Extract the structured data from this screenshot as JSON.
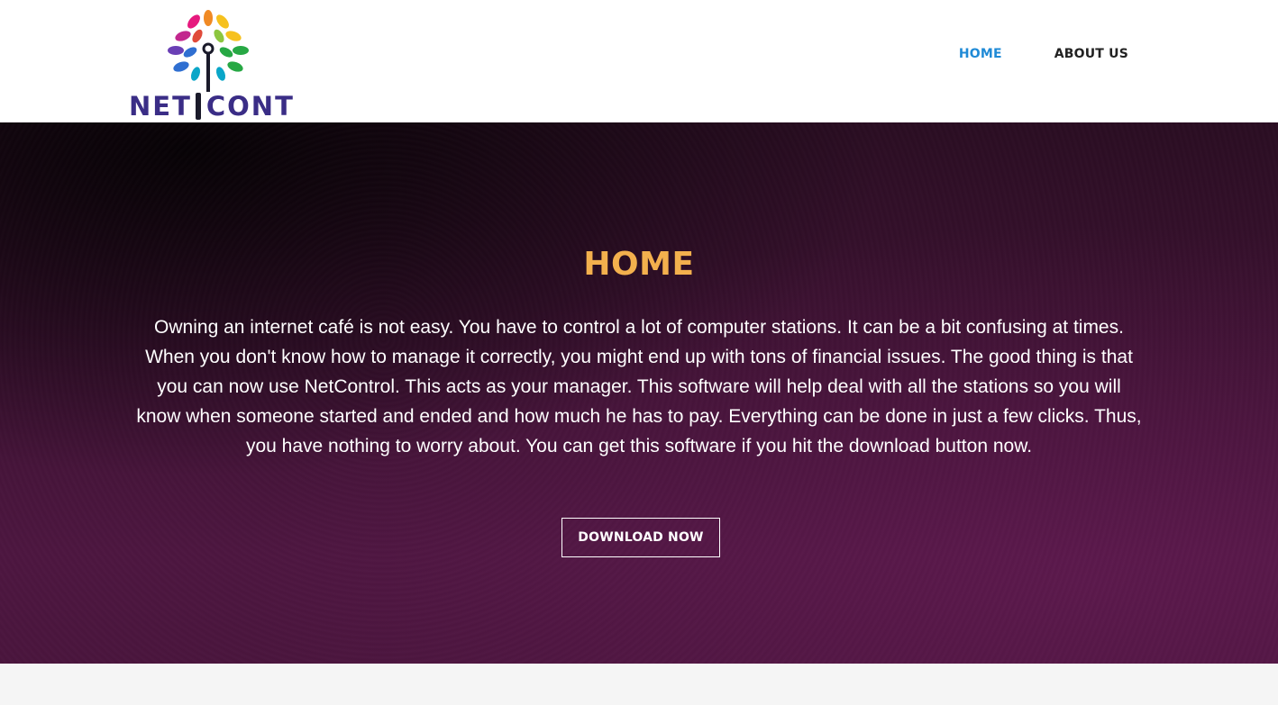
{
  "brand": {
    "name_left": "NET",
    "name_right": "CONT",
    "logo_icon": "tree-of-petals-icon",
    "brand_color": "#3a2d86",
    "petal_colors": [
      "#e6197e",
      "#f08a24",
      "#f6c11e",
      "#8dc63f",
      "#27a844",
      "#0aa6c8",
      "#2f6fd1",
      "#6a3fb5",
      "#c2278e"
    ]
  },
  "nav": {
    "items": [
      {
        "label": "HOME",
        "active": true
      },
      {
        "label": "ABOUT US",
        "active": false
      }
    ],
    "active_color": "#1f8ad6"
  },
  "hero": {
    "title": "HOME",
    "title_color": "#f3b04d",
    "body": "Owning an internet café is not easy. You have to control a lot of computer stations. It can be a bit confusing at times. When you don't know how to manage it correctly, you might end up with tons of financial issues. The good thing is that you can now use NetControl. This acts as your manager. This software will help deal with all the stations so you will know when someone started and ended and how much he has to pay. Everything can be done in just a few clicks. Thus, you have nothing to worry about. You can get this software if you hit the download button now.",
    "button_label": "DOWNLOAD NOW"
  }
}
